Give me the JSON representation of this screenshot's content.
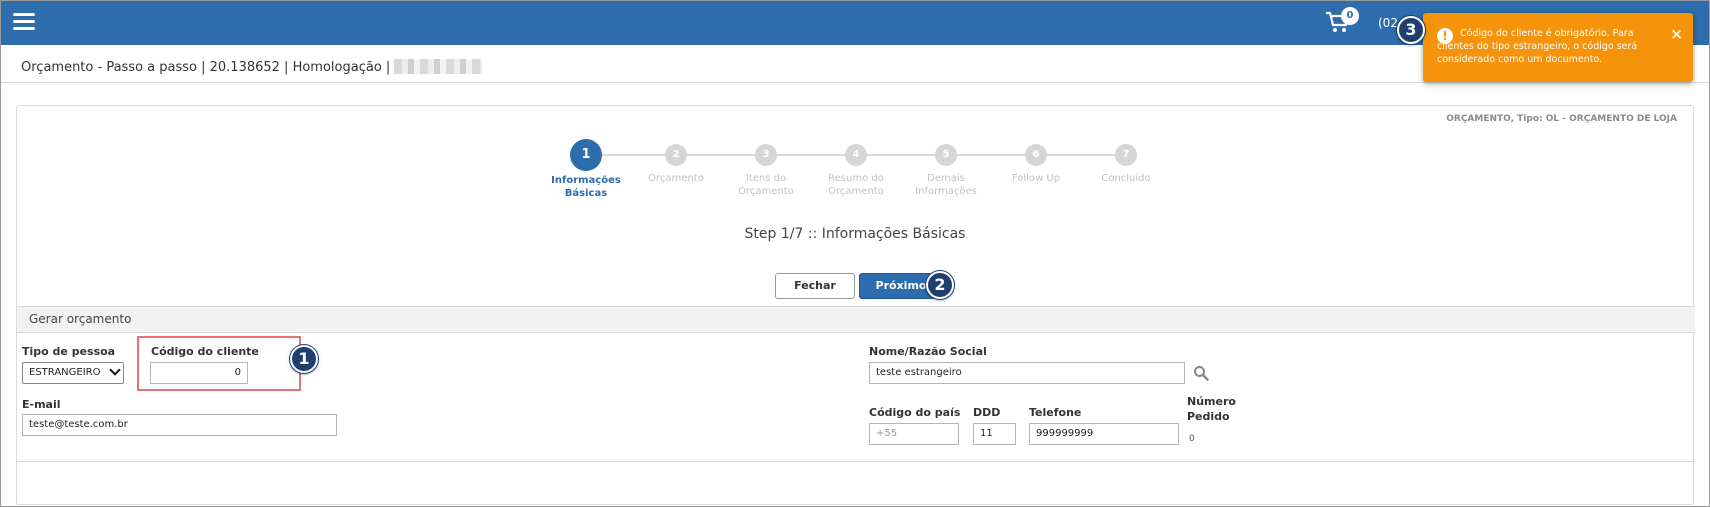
{
  "header": {
    "cart_count": "0",
    "partial_text": "(02"
  },
  "page": {
    "title": "Orçamento - Passo a passo | 20.138652 | Homologação |"
  },
  "panel": {
    "type_info": "ORÇAMENTO, Tipo: OL - ORÇAMENTO DE LOJA",
    "steps": [
      {
        "num": "1",
        "label_line1": "Informações",
        "label_line2": "Básicas"
      },
      {
        "num": "2",
        "label_line1": "Orçamento",
        "label_line2": ""
      },
      {
        "num": "3",
        "label_line1": "Itens do",
        "label_line2": "Orçamento"
      },
      {
        "num": "4",
        "label_line1": "Resumo do",
        "label_line2": "Orçamento"
      },
      {
        "num": "5",
        "label_line1": "Demais",
        "label_line2": "Informações"
      },
      {
        "num": "6",
        "label_line1": "Follow Up",
        "label_line2": ""
      },
      {
        "num": "7",
        "label_line1": "Concluído",
        "label_line2": ""
      }
    ],
    "step_heading": "Step 1/7 :: Informações Básicas",
    "buttons": {
      "close": "Fechar",
      "next": "Próximo"
    }
  },
  "form": {
    "section_title": "Gerar orçamento",
    "tipo_pessoa": {
      "label": "Tipo de pessoa",
      "value": "ESTRANGEIRO"
    },
    "codigo_cliente": {
      "label": "Código do cliente",
      "value": "0"
    },
    "email": {
      "label": "E-mail",
      "value": "teste@teste.com.br"
    },
    "nome": {
      "label": "Nome/Razão Social",
      "value": "teste estrangeiro"
    },
    "codigo_pais": {
      "label": "Código do país",
      "placeholder": "+55"
    },
    "ddd": {
      "label": "DDD",
      "value": "11"
    },
    "telefone": {
      "label": "Telefone",
      "value": "999999999"
    },
    "numero_pedido": {
      "label_line1": "Número",
      "label_line2": "Pedido",
      "value": "0"
    }
  },
  "callouts": {
    "one": "1",
    "two": "2",
    "three": "3"
  },
  "toast": {
    "message": "Código do cliente é obrigatório. Para clientes do tipo estrangeiro, o código será considerado como um documento.",
    "icon": "!",
    "close": "×"
  },
  "colors": {
    "primary": "#2d6cad",
    "warning": "#f5930a",
    "highlight": "#e57373",
    "callout": "#1f3f6f"
  }
}
